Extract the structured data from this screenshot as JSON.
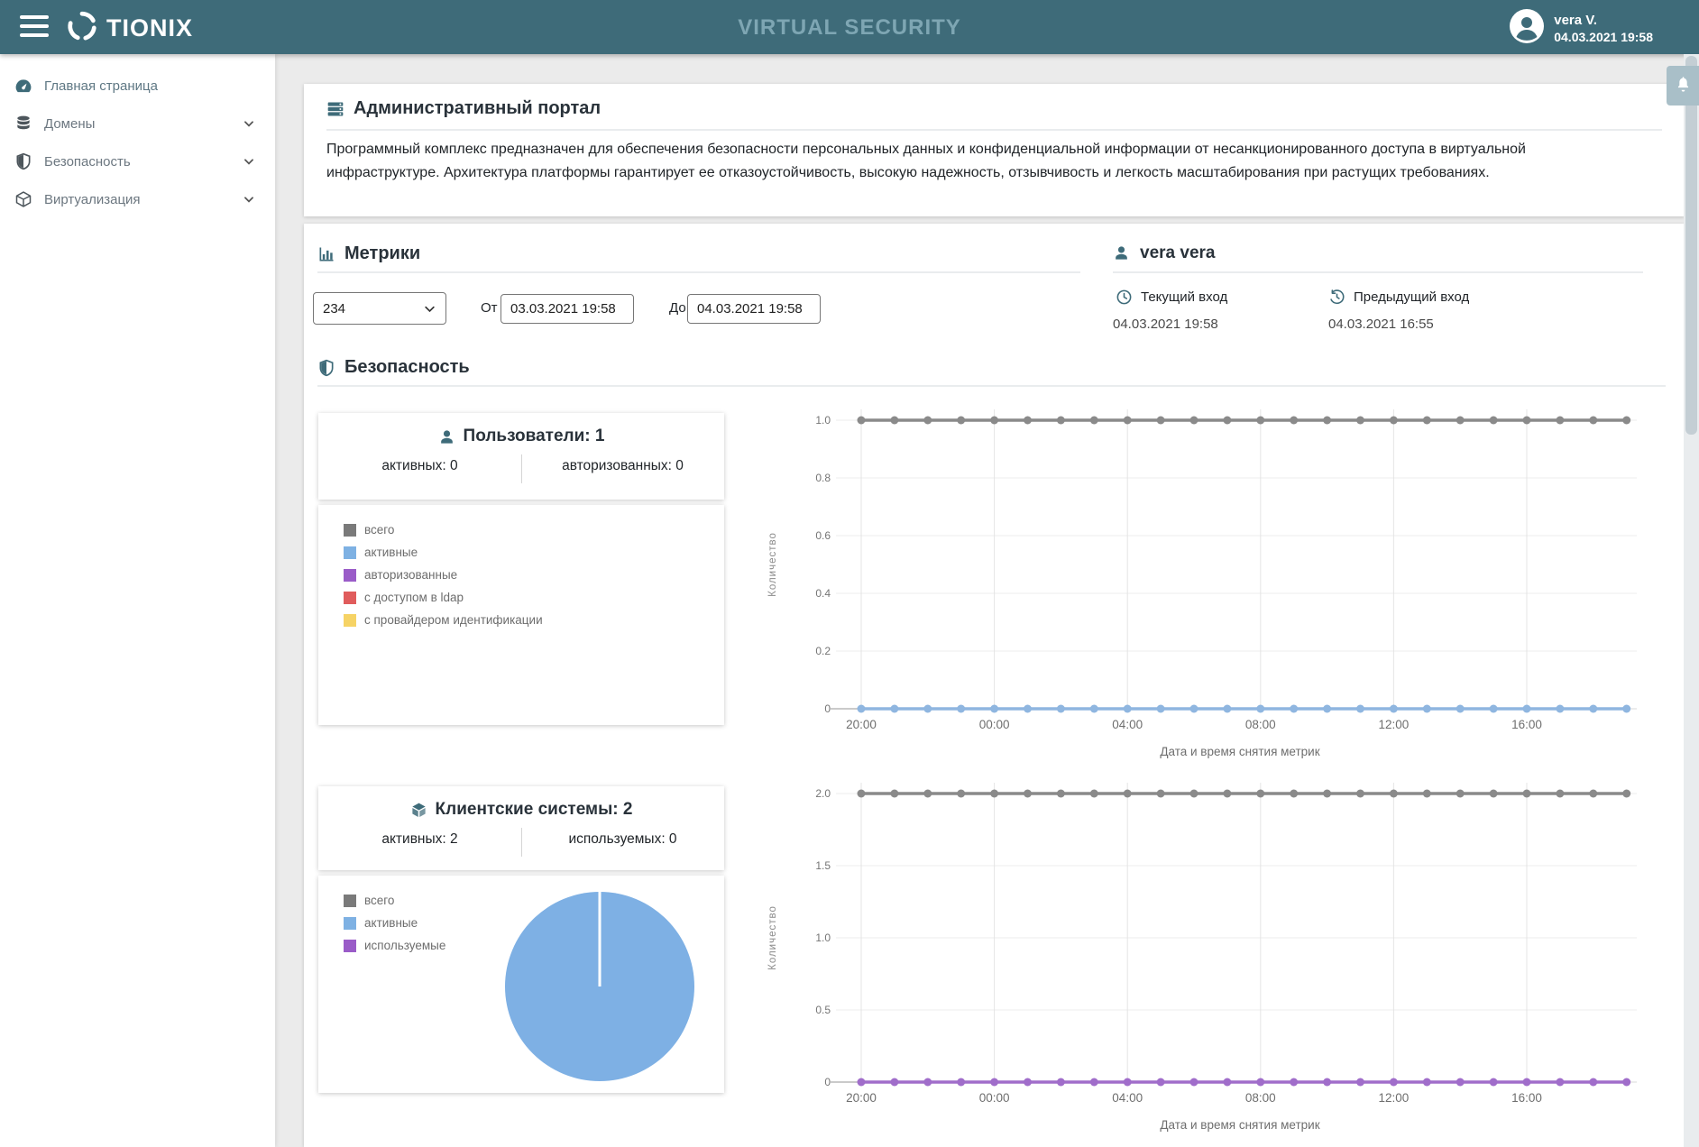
{
  "header": {
    "brand": "TIONIX",
    "title": "VIRTUAL SECURITY",
    "user_name": "vera V.",
    "user_datetime": "04.03.2021 19:58"
  },
  "sidebar": {
    "items": [
      {
        "label": "Главная страница",
        "icon": "dashboard-icon",
        "expandable": false,
        "active": true
      },
      {
        "label": "Домены",
        "icon": "database-icon",
        "expandable": true,
        "active": false
      },
      {
        "label": "Безопасность",
        "icon": "shield-icon",
        "expandable": true,
        "active": false
      },
      {
        "label": "Виртуализация",
        "icon": "cube-icon",
        "expandable": true,
        "active": false
      }
    ]
  },
  "intro": {
    "title": "Административный портал",
    "description": "Программный комплекс предназначен для обеспечения безопасности персональных данных и конфиденциальной информации от несанкционированного доступа в виртуальной инфраструктуре. Архитектура платформы гарантирует ее отказоустойчивость, высокую надежность, отзывчивость и легкость масштабирования при растущих требованиях."
  },
  "metrics": {
    "title": "Метрики",
    "select_value": "234",
    "from_label": "От",
    "from_value": "03.03.2021 19:58",
    "to_label": "До",
    "to_value": "04.03.2021 19:58"
  },
  "user_panel": {
    "title": "vera vera",
    "current_login_label": "Текущий вход",
    "current_login_value": "04.03.2021 19:58",
    "previous_login_label": "Предыдущий вход",
    "previous_login_value": "04.03.2021 16:55"
  },
  "security": {
    "title": "Безопасность",
    "users_card": {
      "title": "Пользователи: 1",
      "stat_left": "активных: 0",
      "stat_right": "авторизованных: 0",
      "legend": [
        {
          "label": "всего",
          "color": "#7a7a7a"
        },
        {
          "label": "активные",
          "color": "#7eb1e3"
        },
        {
          "label": "авторизованные",
          "color": "#9a5cc8"
        },
        {
          "label": "с доступом в ldap",
          "color": "#e05c5c"
        },
        {
          "label": "с провайдером идентификации",
          "color": "#f6d365"
        }
      ]
    },
    "clients_card": {
      "title": "Клиентские системы: 2",
      "stat_left": "активных: 2",
      "stat_right": "используемых: 0",
      "legend": [
        {
          "label": "всего",
          "color": "#7a7a7a"
        },
        {
          "label": "активные",
          "color": "#7eb1e3"
        },
        {
          "label": "используемые",
          "color": "#9a5cc8"
        }
      ]
    }
  },
  "icons": {
    "menu": "hamburger-icon",
    "brand": "tionix-swirl-icon",
    "user": "avatar-icon",
    "notifications": "bell-icon",
    "intro": "server-stack-icon",
    "metrics": "bar-chart-icon",
    "current_login": "clock-icon",
    "previous_login": "history-icon"
  },
  "colors": {
    "header_bg": "#3e6b79",
    "accent": "#3e6b79",
    "header_title": "#7ea6b3",
    "line_gray": "#8a8a8a",
    "line_blue": "#8fb6e0",
    "line_purple": "#a06dca",
    "pie_blue": "#7eb0e4",
    "bell_bg": "#a9bfc8",
    "main_bg": "#ebebeb"
  },
  "chart_data": [
    {
      "type": "line",
      "title": "Пользователи",
      "ylabel": "Количество",
      "xlabel": "Дата и время снятия метрик",
      "yticks": [
        "0",
        "0.2",
        "0.4",
        "0.6",
        "0.8",
        "1.0"
      ],
      "ylim": [
        0,
        1.0
      ],
      "xticks": [
        "20:00",
        "00:00",
        "04:00",
        "08:00",
        "12:00",
        "16:00"
      ],
      "x_interval": "1h",
      "points_per_tick": 4,
      "grid": true,
      "legend_position": "left-card",
      "series": [
        {
          "name": "всего",
          "color": "#8a8a8a",
          "values": [
            1,
            1,
            1,
            1,
            1,
            1,
            1,
            1,
            1,
            1,
            1,
            1,
            1,
            1,
            1,
            1,
            1,
            1,
            1,
            1,
            1,
            1,
            1,
            1
          ]
        },
        {
          "name": "активные",
          "color": "#8fb6e0",
          "values": [
            0,
            0,
            0,
            0,
            0,
            0,
            0,
            0,
            0,
            0,
            0,
            0,
            0,
            0,
            0,
            0,
            0,
            0,
            0,
            0,
            0,
            0,
            0,
            0
          ]
        }
      ]
    },
    {
      "type": "line",
      "title": "Клиентские системы",
      "ylabel": "Количество",
      "xlabel": "Дата и время снятия метрик",
      "yticks": [
        "0",
        "0.5",
        "1.0",
        "1.5",
        "2.0"
      ],
      "ylim": [
        0,
        2.0
      ],
      "xticks": [
        "20:00",
        "00:00",
        "04:00",
        "08:00",
        "12:00",
        "16:00"
      ],
      "x_interval": "1h",
      "points_per_tick": 4,
      "grid": true,
      "legend_position": "left-card",
      "series": [
        {
          "name": "всего",
          "color": "#8a8a8a",
          "values": [
            2,
            2,
            2,
            2,
            2,
            2,
            2,
            2,
            2,
            2,
            2,
            2,
            2,
            2,
            2,
            2,
            2,
            2,
            2,
            2,
            2,
            2,
            2,
            2
          ]
        },
        {
          "name": "используемые",
          "color": "#a06dca",
          "values": [
            0,
            0,
            0,
            0,
            0,
            0,
            0,
            0,
            0,
            0,
            0,
            0,
            0,
            0,
            0,
            0,
            0,
            0,
            0,
            0,
            0,
            0,
            0,
            0
          ]
        }
      ]
    },
    {
      "type": "pie",
      "title": "Клиентские системы",
      "total": 2,
      "slices": [
        {
          "label": "активные",
          "value": 2,
          "color": "#7eb0e4"
        }
      ]
    }
  ]
}
